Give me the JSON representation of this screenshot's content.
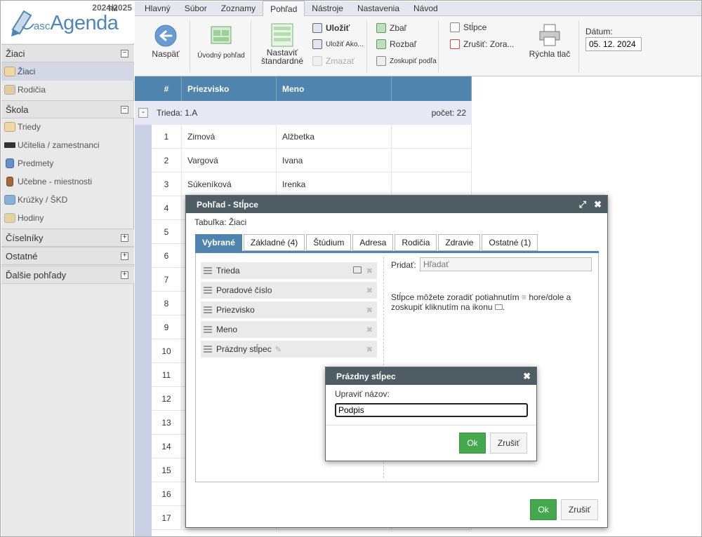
{
  "app": {
    "year": "2024/2025",
    "brand_prefix": "asc",
    "brand_name": "Agenda",
    "trademark": "TM"
  },
  "sidebar": {
    "sections": [
      {
        "label": "Žiaci",
        "toggle": "−",
        "items": [
          {
            "label": "Žiaci",
            "selected": true,
            "icon": "student-icon"
          },
          {
            "label": "Rodičia",
            "icon": "parents-icon"
          }
        ]
      },
      {
        "label": "Škola",
        "toggle": "−",
        "items": [
          {
            "label": "Triedy",
            "icon": "classes-icon"
          },
          {
            "label": "Učitelia / zamestnanci",
            "icon": "graduation-cap-icon"
          },
          {
            "label": "Predmety",
            "icon": "book-icon"
          },
          {
            "label": "Učebne - miestnosti",
            "icon": "door-icon"
          },
          {
            "label": "Krúžky / ŠKD",
            "icon": "clubs-icon"
          },
          {
            "label": "Hodiny",
            "icon": "lessons-icon"
          }
        ]
      },
      {
        "label": "Číselníky",
        "toggle": "+"
      },
      {
        "label": "Ostatné",
        "toggle": "+"
      },
      {
        "label": "Ďalšie pohľady",
        "toggle": "+"
      }
    ]
  },
  "menu": {
    "tabs": [
      "Hlavný",
      "Súbor",
      "Zoznamy",
      "Pohľad",
      "Nástroje",
      "Nastavenia",
      "Návod"
    ],
    "active": "Pohľad"
  },
  "ribbon": {
    "back": "Naspäť",
    "home_view": "Úvodný pohľad",
    "set_default_1": "Nastaviť",
    "set_default_2": "štandardné",
    "save": "Uložiť",
    "save_as": "Uložiť Ako...",
    "delete": "Zmazať",
    "collapse": "Zbaľ",
    "expand": "Rozbaľ",
    "group_by": "Zoskupiť podľa",
    "columns": "Stĺpce",
    "cancel_sort": "Zrušiť: Zora...",
    "quick_print": "Rýchla tlač",
    "date_label": "Dátum:",
    "date_value": "05. 12. 2024"
  },
  "grid": {
    "headers": {
      "num": "#",
      "surname": "Priezvisko",
      "name": "Meno"
    },
    "group": {
      "toggle": "-",
      "label": "Trieda: 1.A",
      "count": "počet: 22"
    },
    "rows": [
      {
        "n": "1",
        "p": "Zimová",
        "m": "Alžbetka"
      },
      {
        "n": "2",
        "p": "Vargová",
        "m": "Ivana"
      },
      {
        "n": "3",
        "p": "Súkeníková",
        "m": "Irenka"
      },
      {
        "n": "4",
        "p": "",
        "m": ""
      },
      {
        "n": "5",
        "p": "",
        "m": ""
      },
      {
        "n": "6",
        "p": "",
        "m": ""
      },
      {
        "n": "7",
        "p": "",
        "m": ""
      },
      {
        "n": "8",
        "p": "",
        "m": ""
      },
      {
        "n": "9",
        "p": "",
        "m": ""
      },
      {
        "n": "10",
        "p": "",
        "m": ""
      },
      {
        "n": "11",
        "p": "",
        "m": ""
      },
      {
        "n": "12",
        "p": "",
        "m": ""
      },
      {
        "n": "13",
        "p": "",
        "m": ""
      },
      {
        "n": "14",
        "p": "",
        "m": ""
      },
      {
        "n": "15",
        "p": "",
        "m": ""
      },
      {
        "n": "16",
        "p": "",
        "m": ""
      },
      {
        "n": "17",
        "p": "",
        "m": ""
      }
    ]
  },
  "dialog": {
    "title": "Pohľad - Stĺpce",
    "table_label": "Tabuľka: Žiaci",
    "tabs": [
      "Vybrané",
      "Základné (4)",
      "Štúdium",
      "Adresa",
      "Rodičia",
      "Zdravie",
      "Ostatné (1)"
    ],
    "active_tab": "Vybrané",
    "columns": [
      "Trieda",
      "Poradové číslo",
      "Priezvisko",
      "Meno",
      "Prázdny stĺpec"
    ],
    "add_label": "Pridať:",
    "search_placeholder": "Hľadať",
    "hint_1": "Stĺpce môžete zoradiť potiahnutím",
    "hint_2": "hore/dole a",
    "hint_3": "zoskupiť kliknutím na ikonu",
    "hint_4": ".",
    "ok": "Ok",
    "cancel": "Zrušiť"
  },
  "subdialog": {
    "title": "Prázdny stĺpec",
    "label": "Upraviť názov:",
    "value": "Podpis",
    "ok": "Ok",
    "cancel": "Zrušiť"
  }
}
